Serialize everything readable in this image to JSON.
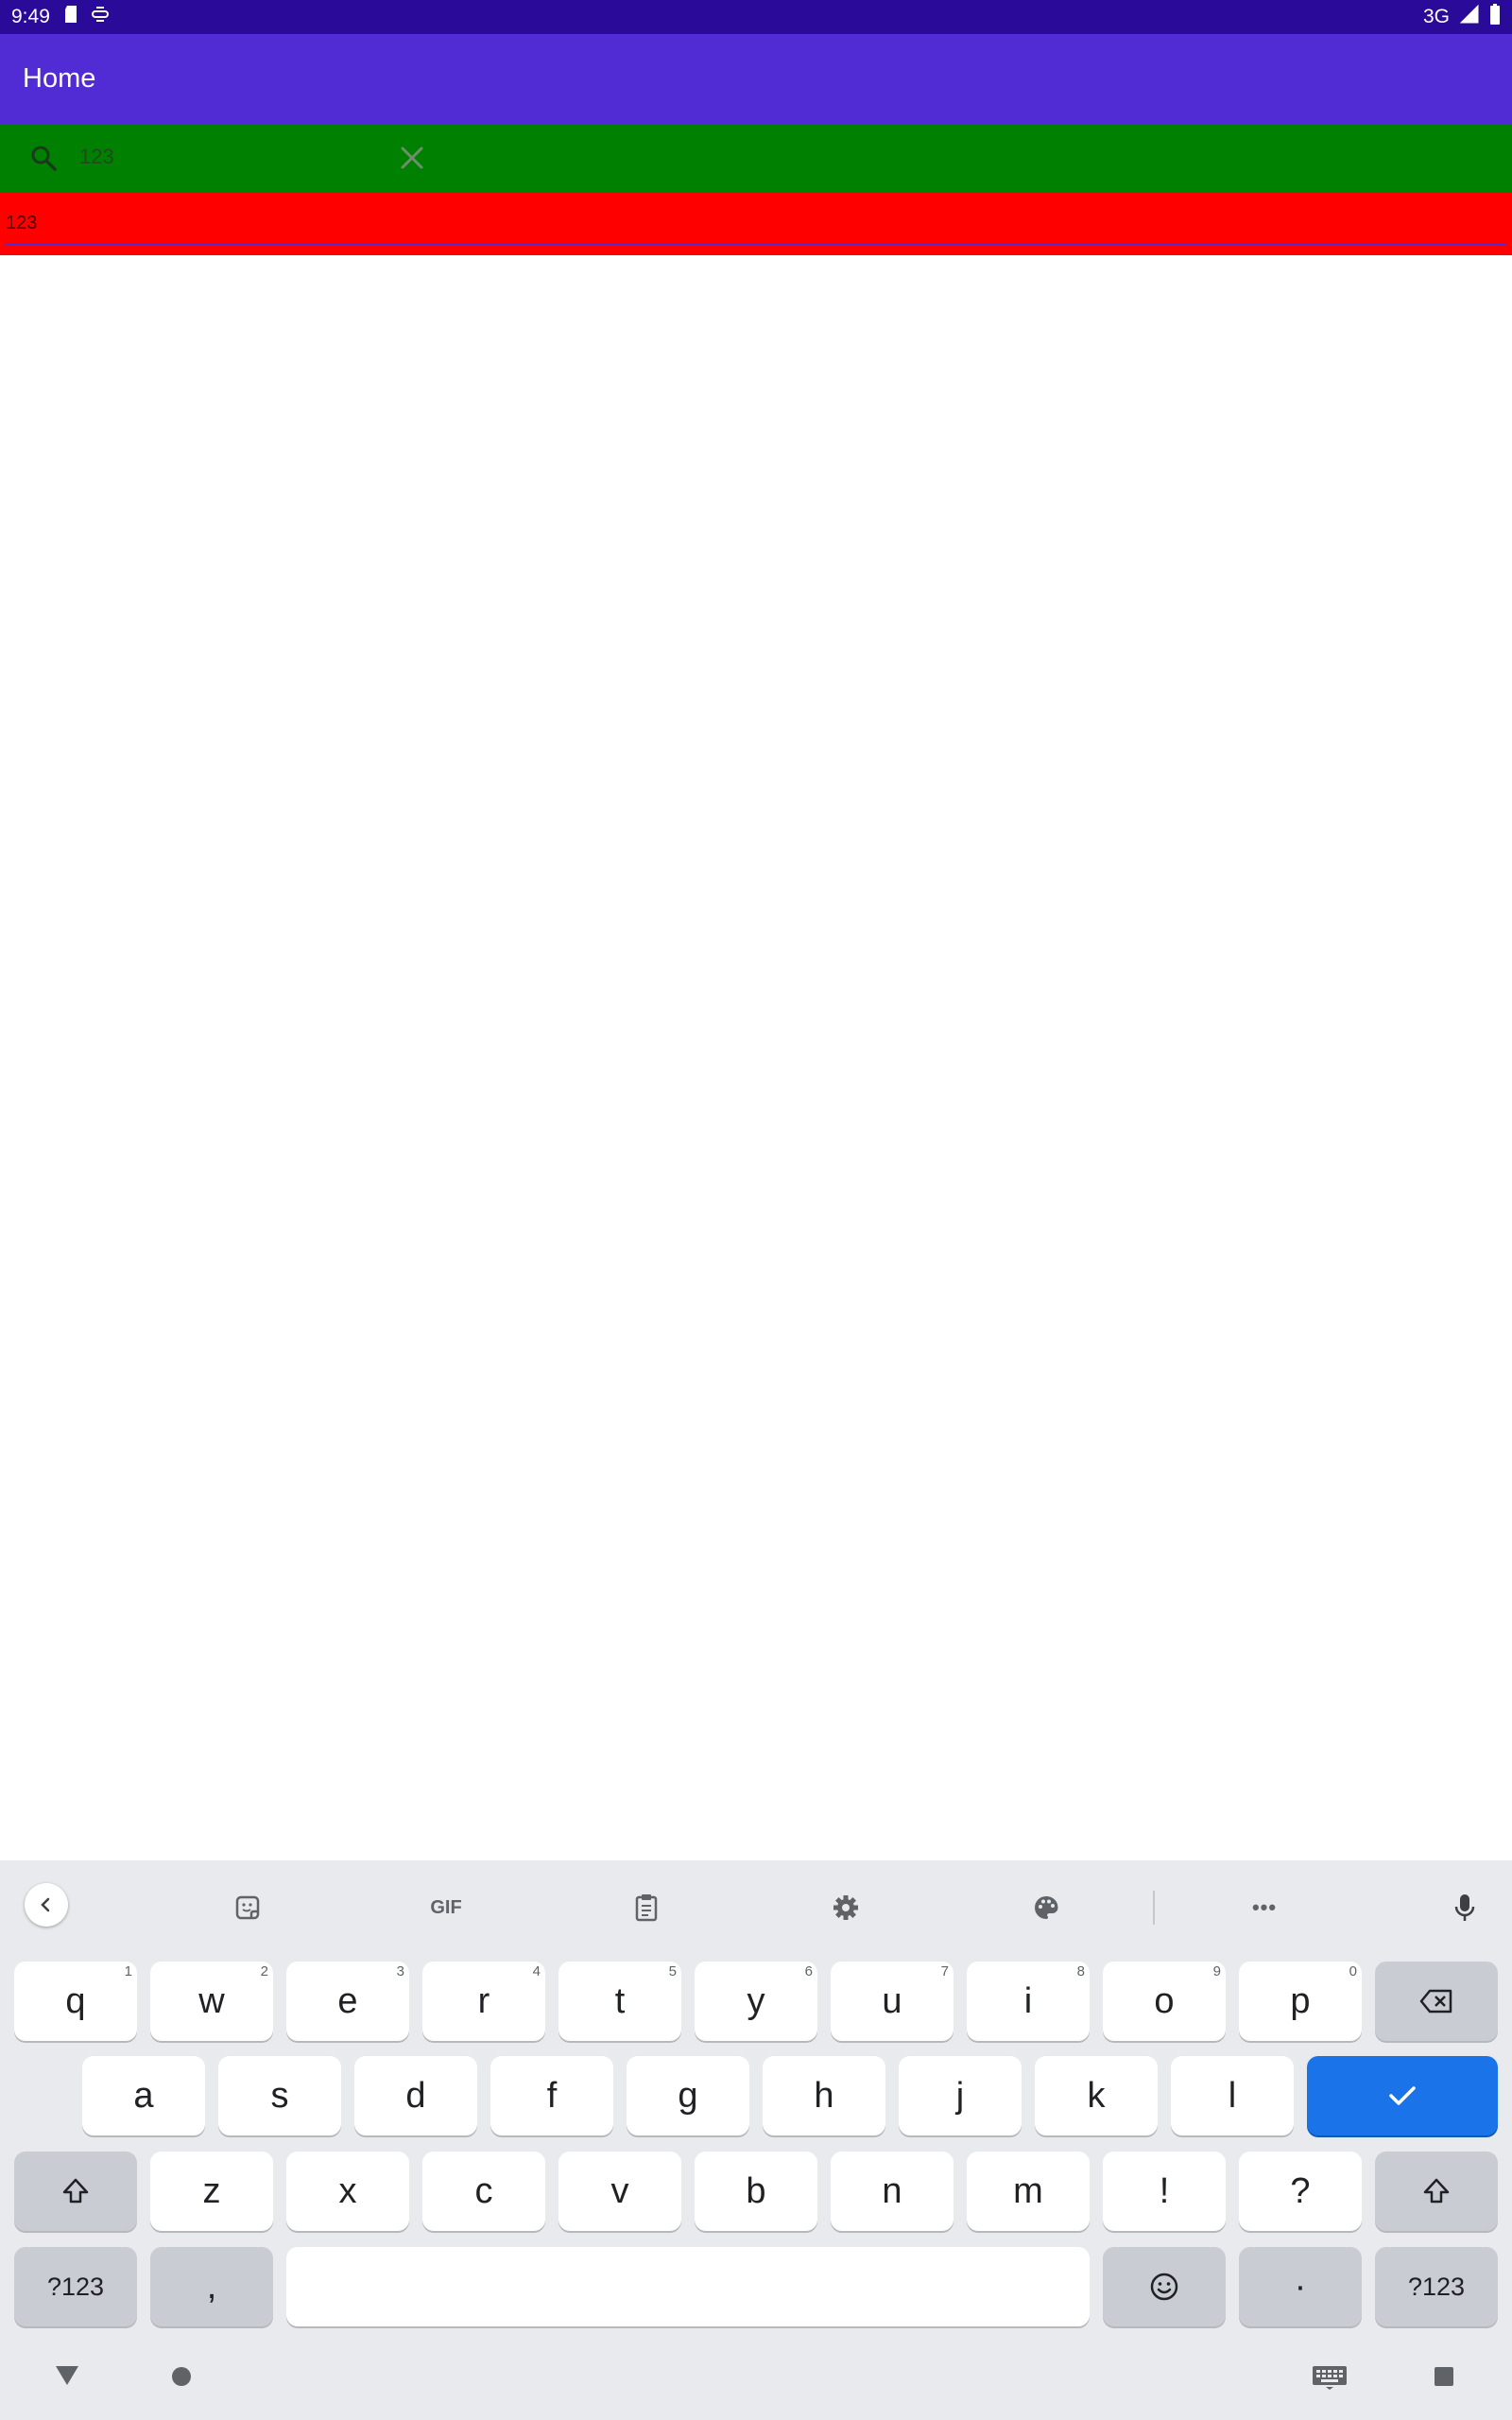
{
  "status_bar": {
    "time": "9:49",
    "network": "3G",
    "icons": [
      "sd-card-icon",
      "sim-icon",
      "signal-icon",
      "battery-icon"
    ]
  },
  "app_bar": {
    "title": "Home"
  },
  "search_bar": {
    "query": "123",
    "icons": [
      "search-icon",
      "close-icon"
    ]
  },
  "entry": {
    "value": "123"
  },
  "keyboard": {
    "toolbar": [
      "back-chevron-icon",
      "sticker-icon",
      "gif-icon",
      "clipboard-icon",
      "settings-gear-icon",
      "palette-icon",
      "more-icon",
      "microphone-icon"
    ],
    "gif_label": "GIF",
    "more_label": "•••",
    "row1": [
      {
        "label": "q",
        "hint": "1"
      },
      {
        "label": "w",
        "hint": "2"
      },
      {
        "label": "e",
        "hint": "3"
      },
      {
        "label": "r",
        "hint": "4"
      },
      {
        "label": "t",
        "hint": "5"
      },
      {
        "label": "y",
        "hint": "6"
      },
      {
        "label": "u",
        "hint": "7"
      },
      {
        "label": "i",
        "hint": "8"
      },
      {
        "label": "o",
        "hint": "9"
      },
      {
        "label": "p",
        "hint": "0"
      }
    ],
    "row2": [
      "a",
      "s",
      "d",
      "f",
      "g",
      "h",
      "j",
      "k",
      "l"
    ],
    "row3": [
      "z",
      "x",
      "c",
      "v",
      "b",
      "n",
      "m",
      "!",
      "?"
    ],
    "symbols_label": "?123",
    "comma_label": ",",
    "period_label": "·",
    "accent_color": "#1a73e8"
  },
  "nav_bar": {
    "icons": [
      "back-triangle-icon",
      "home-circle-icon",
      "keyboard-switch-icon",
      "recents-square-icon"
    ]
  },
  "colors": {
    "status_bar": "#2a0b99",
    "app_bar": "#512bd4",
    "search_bar": "#008000",
    "entry": "#ff0000"
  }
}
